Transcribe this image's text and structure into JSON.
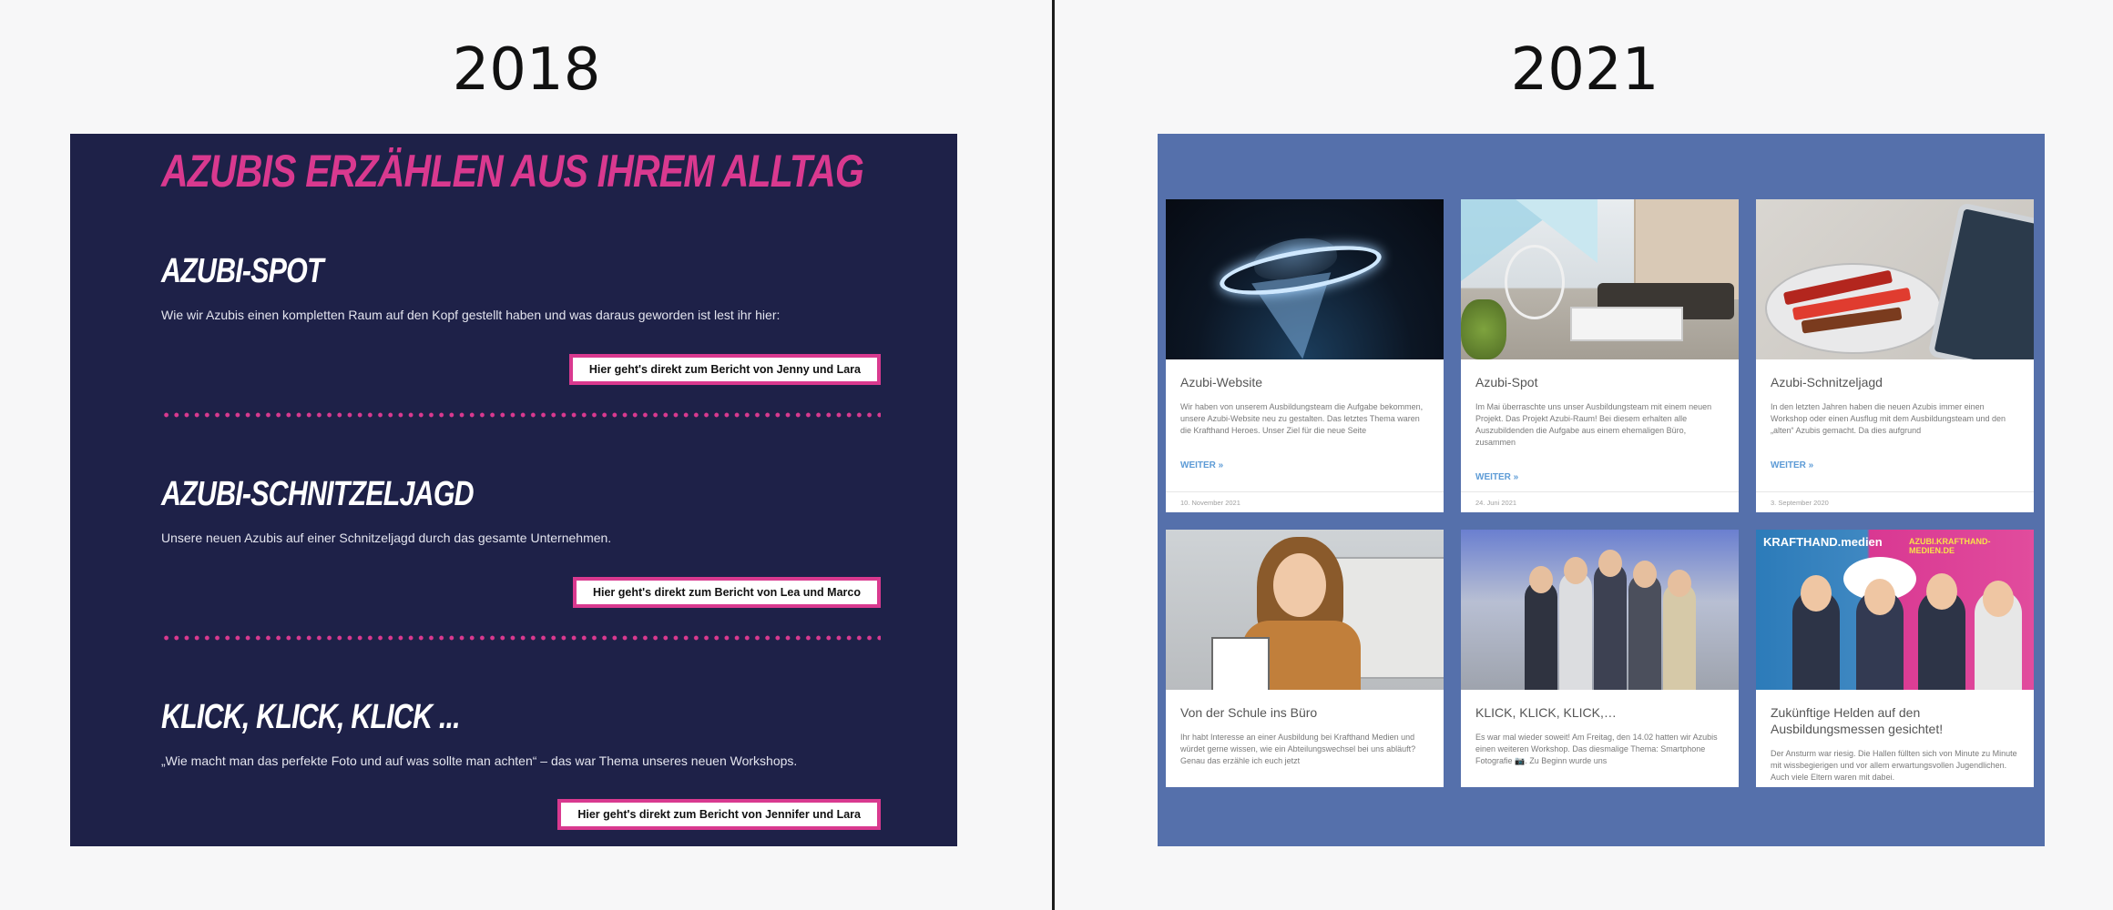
{
  "left": {
    "year": "2018",
    "title": "Azubis erzählen aus ihrem Alltag",
    "sections": [
      {
        "heading": "Azubi-Spot",
        "text": "Wie wir Azubis einen kompletten Raum auf den Kopf gestellt haben und was daraus geworden ist lest ihr hier:",
        "button": "Hier geht's direkt zum Bericht von Jenny und Lara"
      },
      {
        "heading": "Azubi-Schnitzeljagd",
        "text": "Unsere neuen Azubis auf einer Schnitzeljagd durch das gesamte Unternehmen.",
        "button": "Hier geht's direkt zum Bericht von Lea und Marco"
      },
      {
        "heading": "Klick, Klick, Klick ...",
        "text": "„Wie macht man das perfekte Foto und auf was sollte man achten“ – das war Thema unseres neuen Workshops.",
        "button": "Hier geht's direkt zum Bericht von Jennifer und Lara"
      }
    ],
    "colors": {
      "background": "#1e2148",
      "accent": "#d9398f"
    }
  },
  "right": {
    "year": "2021",
    "cards": [
      {
        "image": "ufo-image",
        "title": "Azubi-Website",
        "text": "Wir haben von unserem Ausbildungsteam die Aufgabe bekommen, unsere Azubi-Website neu zu gestalten. Das letztes Thema waren die Krafthand Heroes. Unser Ziel für die neue Seite",
        "more": "WEITER »",
        "date": "10. November 2021"
      },
      {
        "image": "room-image",
        "title": "Azubi-Spot",
        "text": "Im Mai überraschte uns unser Ausbildungsteam mit einem neuen Projekt. Das Projekt Azubi-Raum! Bei diesem erhalten alle Auszubildenden die Aufgabe aus einem ehemaligen Büro, zusammen",
        "more": "WEITER »",
        "date": "24. Juni 2021"
      },
      {
        "image": "chocolate-image",
        "title": "Azubi-Schnitzeljagd",
        "text": "In den letzten Jahren haben die neuen Azubis immer einen Workshop oder einen Ausflug mit dem Ausbildungsteam und den „alten“ Azubis gemacht. Da dies aufgrund",
        "more": "WEITER »",
        "date": "3. September 2020"
      },
      {
        "image": "office-girl-image",
        "title": "Von der Schule ins Büro",
        "text": "Ihr habt Interesse an einer Ausbildung bei Krafthand Medien und würdet gerne wissen, wie ein Abteilungswechsel bei uns abläuft? Genau das erzähle ich euch jetzt",
        "more": "",
        "date": ""
      },
      {
        "image": "group-image",
        "title": "KLICK, KLICK, KLICK,…",
        "text": "Es war mal wieder soweit! Am Freitag, den 14.02 hatten wir Azubis einen weiteren Workshop. Das diesmalige Thema: Smartphone Fotografie 📷. Zu Beginn wurde uns",
        "more": "",
        "date": ""
      },
      {
        "image": "fair-image",
        "title": "Zukünftige Helden auf den Ausbildungsmessen gesichtet!",
        "text": "Der Ansturm war riesig. Die Hallen füllten sich von Minute zu Minute mit wissbegierigen und vor allem erwartungsvollen Jugendlichen. Auch viele Eltern waren mit dabei.",
        "more": "",
        "date": ""
      }
    ],
    "fair_banner_left": "KRAFTHAND.medien",
    "fair_banner_right": "AZUBI.KRAFTHAND-MEDIEN.DE",
    "colors": {
      "background": "#5570ab",
      "link": "#5d9bd6"
    }
  }
}
